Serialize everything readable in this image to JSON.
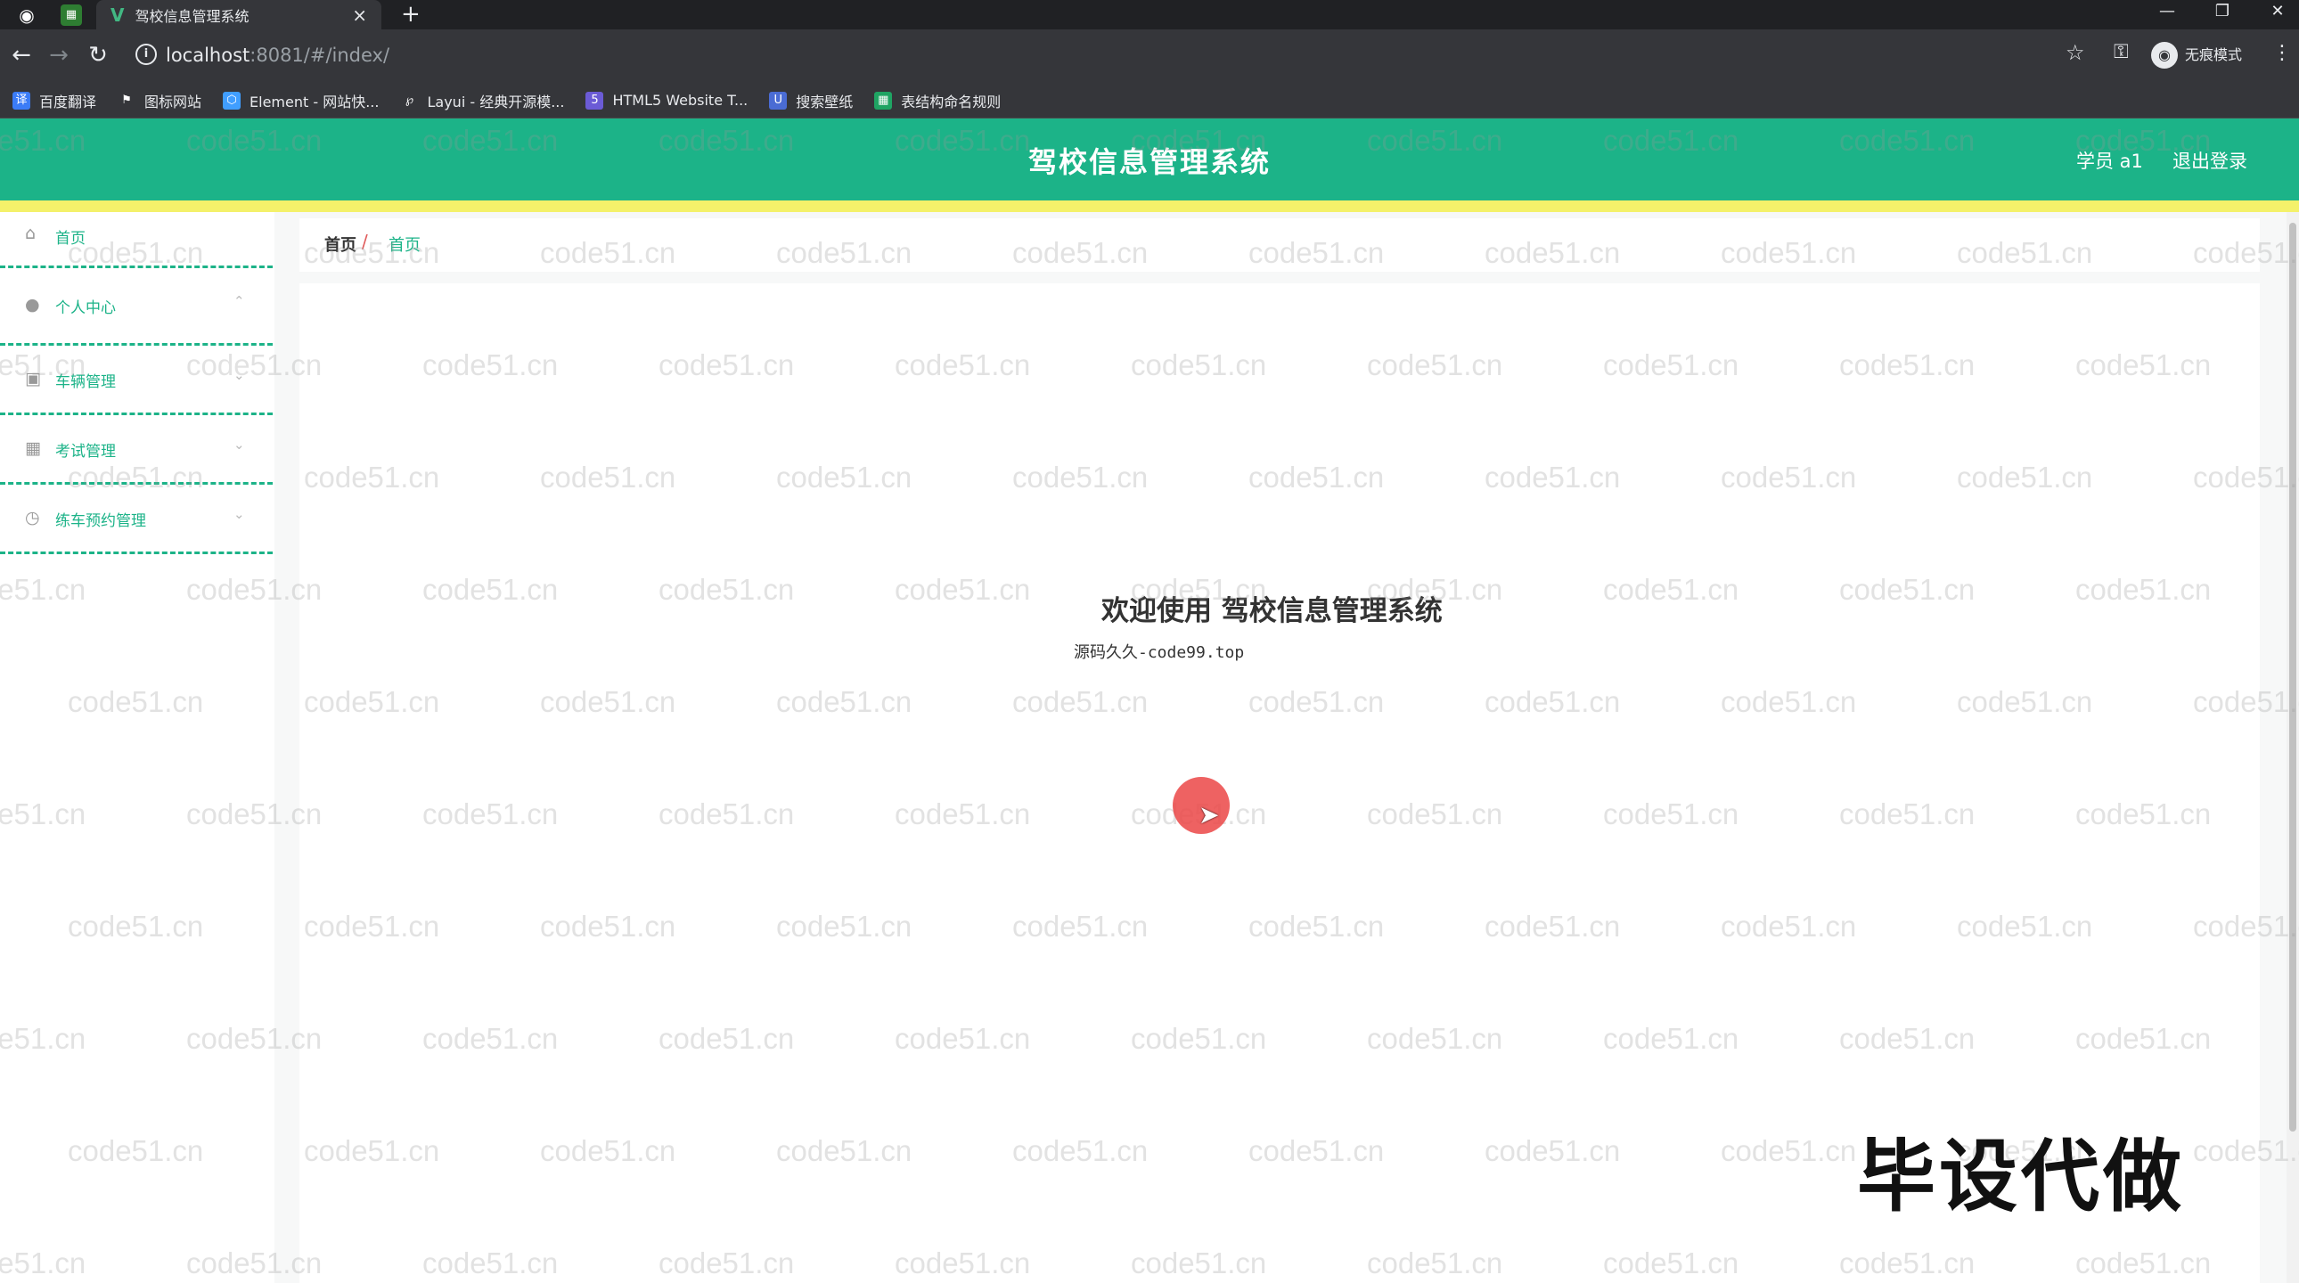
{
  "browser": {
    "tab_title": "驾校信息管理系统",
    "tab_close": "×",
    "new_tab": "+",
    "url_host": "localhost",
    "url_rest": ":8081/#/index/",
    "incognito_label": "无痕模式",
    "bookmarks": [
      {
        "label": "百度翻译",
        "icon": "translate-icon",
        "color": "#3b7cf7"
      },
      {
        "label": "图标网站",
        "icon": "flag-icon",
        "color": "#35363a"
      },
      {
        "label": "Element - 网站快...",
        "icon": "element-icon",
        "color": "#409eff"
      },
      {
        "label": "Layui - 经典开源模...",
        "icon": "layui-icon",
        "color": "#35363a"
      },
      {
        "label": "HTML5 Website T...",
        "icon": "html5-icon",
        "color": "#6b5bd6"
      },
      {
        "label": "搜索壁纸",
        "icon": "wallpaper-icon",
        "color": "#4a6cd4"
      },
      {
        "label": "表结构命名规则",
        "icon": "sheet-icon",
        "color": "#1fa463"
      }
    ]
  },
  "header": {
    "title": "驾校信息管理系统",
    "user": "学员 a1",
    "logout": "退出登录",
    "bg_color": "#1cb388",
    "accent_line": "#f4f16a"
  },
  "sidebar": {
    "items": [
      {
        "label": "首页",
        "icon": "home-icon"
      },
      {
        "label": "个人中心",
        "icon": "user-icon"
      },
      {
        "label": "车辆管理",
        "icon": "car-icon"
      },
      {
        "label": "考试管理",
        "icon": "grid-icon"
      },
      {
        "label": "练车预约管理",
        "icon": "clock-icon"
      }
    ]
  },
  "breadcrumb": {
    "home": "首页",
    "separator": "/",
    "current": "首页"
  },
  "main": {
    "welcome": "欢迎使用 驾校信息管理系统",
    "subtext": "源码久久-code99.top"
  },
  "overlay": {
    "watermark": "code51.cn",
    "promo": "毕设代做"
  }
}
